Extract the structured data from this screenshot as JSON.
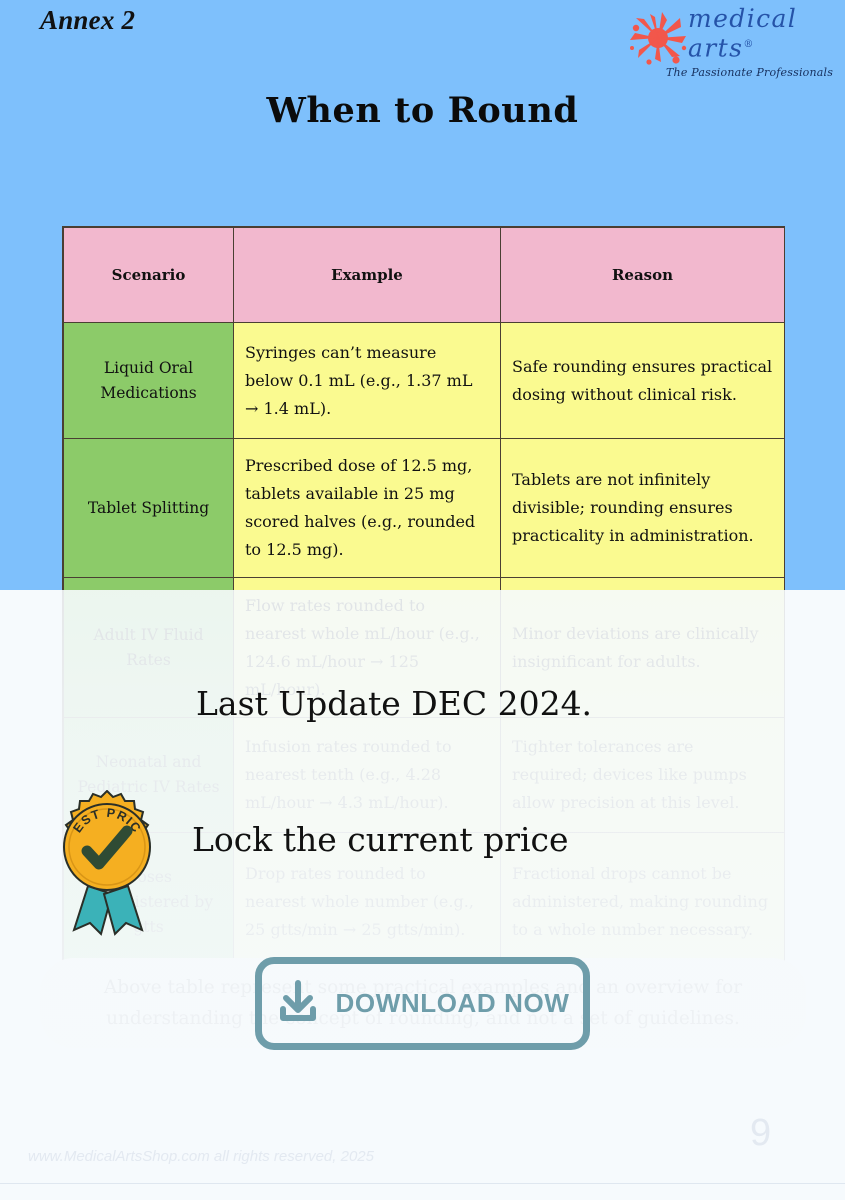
{
  "header": {
    "annex_label": "Annex 2",
    "title": "When to Round",
    "background_color": "#7EC0FC",
    "logo": {
      "name_line1": "medical",
      "name_line2": "arts",
      "registered_mark": "®",
      "tagline": "The Passionate Professionals",
      "mark_color": "#F2574B",
      "text_color": "#2553A8"
    }
  },
  "table": {
    "columns": [
      "Scenario",
      "Example",
      "Reason"
    ],
    "header_color": "#F2B8CE",
    "scenario_color": "#8CCB69",
    "cell_color": "#FAFA90",
    "rows": [
      {
        "scenario": "Liquid Oral Medications",
        "example": "Syringes can’t measure below 0.1 mL (e.g., 1.37 mL → 1.4 mL).",
        "reason": "Safe rounding ensures practical dosing without clinical risk."
      },
      {
        "scenario": "Tablet Splitting",
        "example": "Prescribed dose of 12.5 mg, tablets available in 25 mg scored halves (e.g., rounded to 12.5 mg).",
        "reason": "Tablets are not infinitely divisible; rounding ensures practicality in administration."
      },
      {
        "scenario": "Adult IV Fluid Rates",
        "example": "Flow rates rounded to nearest whole mL/hour (e.g., 124.6 mL/hour → 125 mL/hour).",
        "reason": "Minor deviations are clinically insignificant for adults."
      },
      {
        "scenario": "Neonatal and Pediatric IV Rates",
        "example": "Infusion rates rounded to nearest tenth (e.g., 4.28 mL/hour → 4.3 mL/hour).",
        "reason": "Tighter tolerances are required; devices like pumps allow precision at this level."
      },
      {
        "scenario": "Doses Administered by gtts",
        "example": "Drop rates rounded to nearest whole number (e.g., 25 gtts/min → 25 gtts/min).",
        "reason": "Fractional drops cannot be administered, making rounding to a whole number necessary."
      }
    ]
  },
  "note": "Above table represent some practical examples and an overview for understanding the concept of rounding, and not a set of guidelines.",
  "promo": {
    "last_update": "Last Update DEC 2024.",
    "lock_price": "Lock the current price",
    "badge_text": "BEST PRICE",
    "badge_color": "#F5AF21",
    "badge_ribbon_color": "#3BB2B8",
    "download_label": "DOWNLOAD NOW",
    "download_color": "#6E9DAA"
  },
  "footer": {
    "copyright": "www.MedicalArtsShop.com all rights reserved, 2025",
    "page_number": "9"
  }
}
